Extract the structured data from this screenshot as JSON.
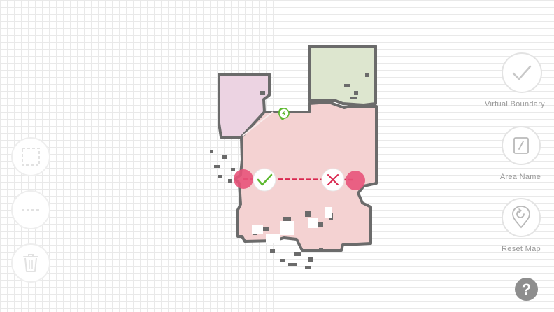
{
  "toolbar_right": {
    "virtual_boundary_label": "Virtual Boundary",
    "area_name_label": "Area Name",
    "reset_map_label": "Reset Map"
  },
  "toolbar_left": {
    "items": [
      {
        "icon": "rectangle-select-icon"
      },
      {
        "icon": "dashed-line-icon"
      },
      {
        "icon": "trash-icon"
      }
    ]
  },
  "help": {
    "label": "?"
  },
  "map": {
    "dock_icon": "charging-dock-icon",
    "boundary_confirm_icon": "checkmark-icon",
    "boundary_delete_icon": "close-icon"
  },
  "colors": {
    "room_main": "#f4d2d2",
    "room_purple": "#ecd3e2",
    "room_green": "#dde6cf",
    "wall": "#6b6b6b",
    "boundary": "#d9274f",
    "accent_green": "#5cb82e"
  }
}
